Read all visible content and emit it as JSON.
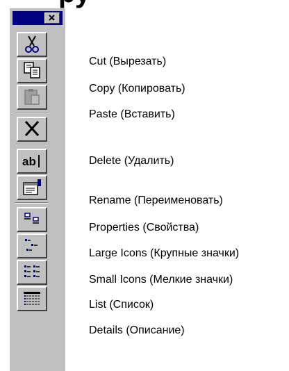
{
  "heading": "ру",
  "toolbar": {
    "colors": {
      "face": "#c0c0c0",
      "title": "#000080",
      "highlight": "#ffffff",
      "shadow": "#404040"
    },
    "close_icon": "close-icon",
    "buttons": [
      {
        "id": "cut",
        "icon": "scissors-icon",
        "label": "Cut (Вырезать)"
      },
      {
        "id": "copy",
        "icon": "copy-icon",
        "label": "Copy (Копировать)"
      },
      {
        "id": "paste",
        "icon": "paste-icon",
        "label": "Paste (Вставить)",
        "disabled": true
      },
      {
        "id": "delete",
        "icon": "delete-x-icon",
        "label": "Delete (Удалить)"
      },
      {
        "id": "rename",
        "icon": "rename-ab-icon",
        "label": "Rename (Переименовать)"
      },
      {
        "id": "properties",
        "icon": "properties-icon",
        "label": "Properties (Свойства)"
      },
      {
        "id": "large-icons",
        "icon": "large-icons-view-icon",
        "label": "Large Icons (Крупные значки)"
      },
      {
        "id": "small-icons",
        "icon": "small-icons-view-icon",
        "label": "Small Icons (Мелкие значки)"
      },
      {
        "id": "list",
        "icon": "list-view-icon",
        "label": "List (Список)"
      },
      {
        "id": "details",
        "icon": "details-view-icon",
        "label": "Details (Описание)"
      }
    ]
  }
}
